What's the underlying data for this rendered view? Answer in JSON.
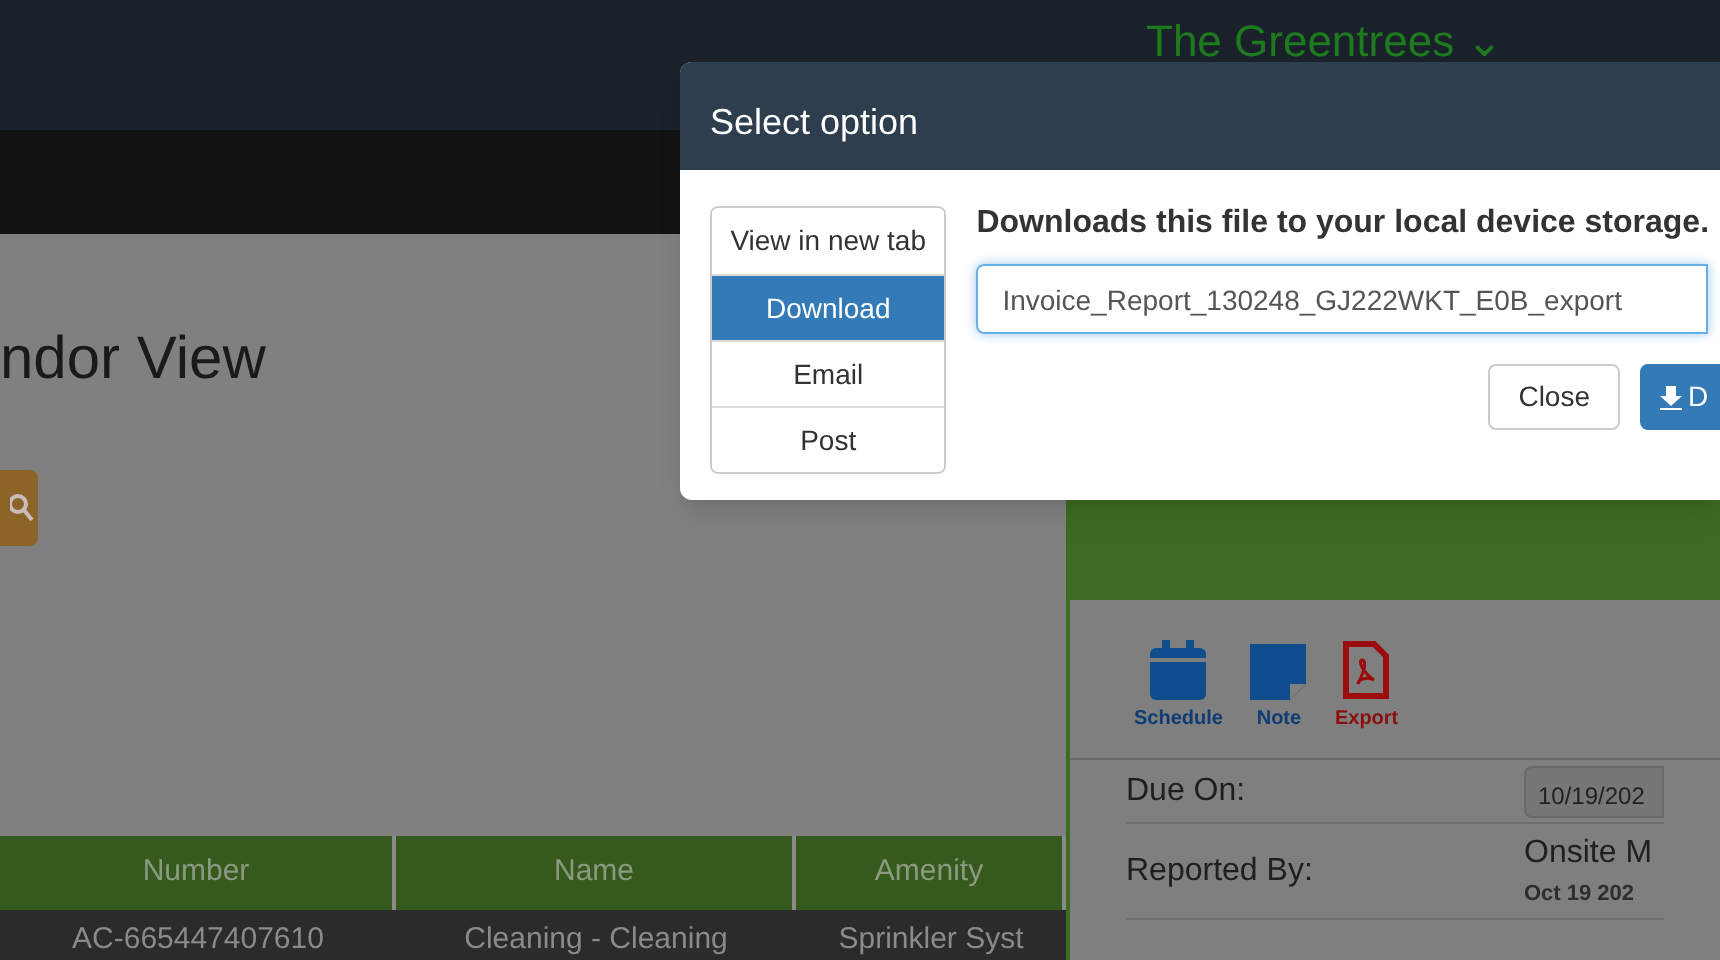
{
  "header": {
    "site": "The Greentrees ⌄"
  },
  "page": {
    "title": "ndor View"
  },
  "table": {
    "columns": [
      "Number",
      "Name",
      "Amenity"
    ],
    "rows": [
      [
        "AC-665447407610",
        "Cleaning - Cleaning",
        "Sprinkler Syst"
      ]
    ]
  },
  "detail_panel": {
    "actions": [
      {
        "kind": "calendar",
        "label": "Schedule"
      },
      {
        "kind": "note",
        "label": "Note"
      },
      {
        "kind": "pdf",
        "label": "Export"
      }
    ],
    "fields": [
      {
        "label": "Due On:",
        "value": "10/19/202"
      },
      {
        "label": "Reported By:",
        "value": "Onsite M",
        "sub": "Oct 19 202"
      }
    ]
  },
  "modal": {
    "title": "Select option",
    "options": [
      {
        "label": "View in new tab",
        "selected": false
      },
      {
        "label": "Download",
        "selected": true
      },
      {
        "label": "Email",
        "selected": false
      },
      {
        "label": "Post",
        "selected": false
      }
    ],
    "description": "Downloads this file to your local device storage.",
    "filename": "Invoice_Report_130248_GJ222WKT_E0B_export",
    "buttons": [
      {
        "kind": "default",
        "label": "Close"
      },
      {
        "kind": "primary",
        "label": "D"
      }
    ]
  }
}
